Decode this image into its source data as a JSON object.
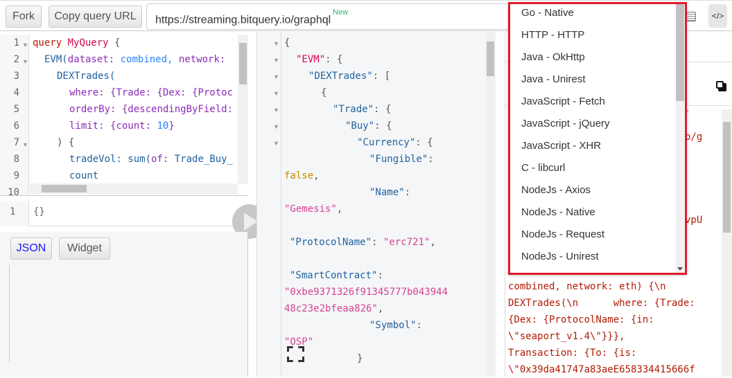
{
  "toolbar": {
    "fork": "Fork",
    "copy_url": "Copy query URL",
    "endpoint": "https://streaming.bitquery.io/graphql",
    "new_badge": "New"
  },
  "query_editor": {
    "lines": [
      {
        "n": "1",
        "fold": true
      },
      {
        "n": "2",
        "fold": true
      },
      {
        "n": "3"
      },
      {
        "n": "4"
      },
      {
        "n": "5"
      },
      {
        "n": "6"
      },
      {
        "n": "7",
        "fold": true
      },
      {
        "n": "8"
      },
      {
        "n": "9"
      },
      {
        "n": "10"
      }
    ],
    "code": {
      "l1a": "query",
      "l1b": "MyQuery",
      "l1c": "{",
      "l2a": "EVM(",
      "l2b": "dataset:",
      "l2c": "combined,",
      "l2d": "network:",
      "l3": "DEXTrades(",
      "l4a": "where:",
      "l4b": "{Trade: {Dex: {Protoc",
      "l5a": "orderBy:",
      "l5b": "{descendingByField:",
      "l6a": "limit:",
      "l6b": "{count:",
      "l6c": "10",
      "l6d": "}",
      "l7": ") {",
      "l8a": "tradeVol:",
      "l8b": "sum(",
      "l8c": "of:",
      "l8d": "Trade_Buy_",
      "l9": "count"
    }
  },
  "variables_editor": {
    "line": "1",
    "value": "{}"
  },
  "result_tabs": {
    "json": "JSON",
    "widget": "Widget"
  },
  "result": {
    "l1": "{",
    "l2k": "\"EVM\"",
    "l2p": ": {",
    "l3k": "\"DEXTrades\"",
    "l3p": ": [",
    "l4": "{",
    "l5k": "\"Trade\"",
    "l5p": ": {",
    "l6k": "\"Buy\"",
    "l6p": ": {",
    "l7k": "\"Currency\"",
    "l7p": ": {",
    "l8k": "\"Fungible\"",
    "l8p": ":",
    "l9v": "false",
    "l9p": ",",
    "l10k": "\"Name\"",
    "l10p": ":",
    "l11v": "\"Gemesis\"",
    "l11p": ",",
    "l12k": "\"ProtocolName\"",
    "l12p": ": ",
    "l12v": "\"erc721\"",
    "l12q": ",",
    "l13k": "\"SmartContract\"",
    "l13p": ":",
    "l14v": "\"0xbe9371326f91345777b043944",
    "l15v": "48c23e2bfeaa826\"",
    "l15p": ",",
    "l16k": "\"Symbol\"",
    "l16p": ":",
    "l17v": "\"OSP\"",
    "l18": "}"
  },
  "code_panel": {
    "partial": [
      "T",
      "p/g",
      "vpU"
    ],
    "lines": [
      "combined, network: eth) {\\n",
      "DEXTrades(\\n      where: {Trade:",
      "{Dex: {ProtocolName: {in:",
      "\\\"seaport_v1.4\\\"}}},",
      "Transaction: {To: {is:",
      "\\\"0x39da41747a83aeE658334415666f"
    ]
  },
  "language_dropdown": {
    "options": [
      "Go - Native",
      "HTTP - HTTP",
      "Java - OkHttp",
      "Java - Unirest",
      "JavaScript - Fetch",
      "JavaScript - jQuery",
      "JavaScript - XHR",
      "C - libcurl",
      "NodeJs - Axios",
      "NodeJs - Native",
      "NodeJs - Request",
      "NodeJs - Unirest"
    ],
    "highlight_color": "#e0192f"
  }
}
